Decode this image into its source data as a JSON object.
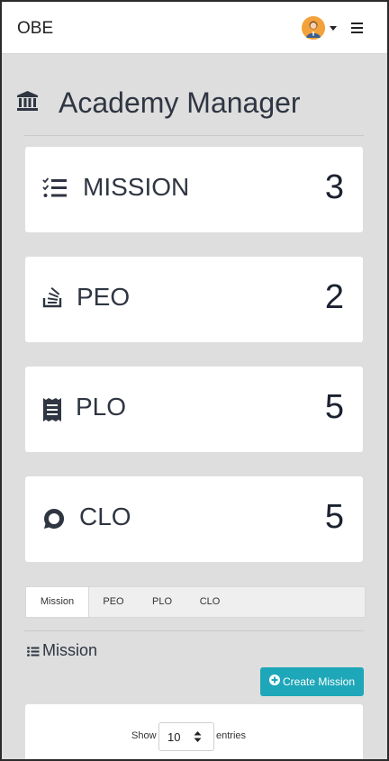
{
  "navbar": {
    "brand": "OBE",
    "avatar_icon": "user-avatar-icon",
    "menu_icon": "hamburger-icon"
  },
  "page": {
    "title": "Academy Manager",
    "title_icon": "university-icon"
  },
  "cards": [
    {
      "label": "MISSION",
      "count": "3",
      "icon": "tasks-list-icon"
    },
    {
      "label": "PEO",
      "count": "2",
      "icon": "stack-icon"
    },
    {
      "label": "PLO",
      "count": "5",
      "icon": "receipt-icon"
    },
    {
      "label": "CLO",
      "count": "5",
      "icon": "chat-bubble-icon"
    }
  ],
  "tabs": [
    {
      "label": "Mission",
      "active": true
    },
    {
      "label": "PEO",
      "active": false
    },
    {
      "label": "PLO",
      "active": false
    },
    {
      "label": "CLO",
      "active": false
    }
  ],
  "section": {
    "title": "Mission",
    "create_button": "Create Mission"
  },
  "table": {
    "show_label": "Show",
    "entries_value": "10",
    "entries_label": "entries"
  },
  "colors": {
    "accent": "#1ea7b8",
    "background": "#dedede",
    "text": "#2f3542",
    "avatar": "#f3a23b"
  }
}
